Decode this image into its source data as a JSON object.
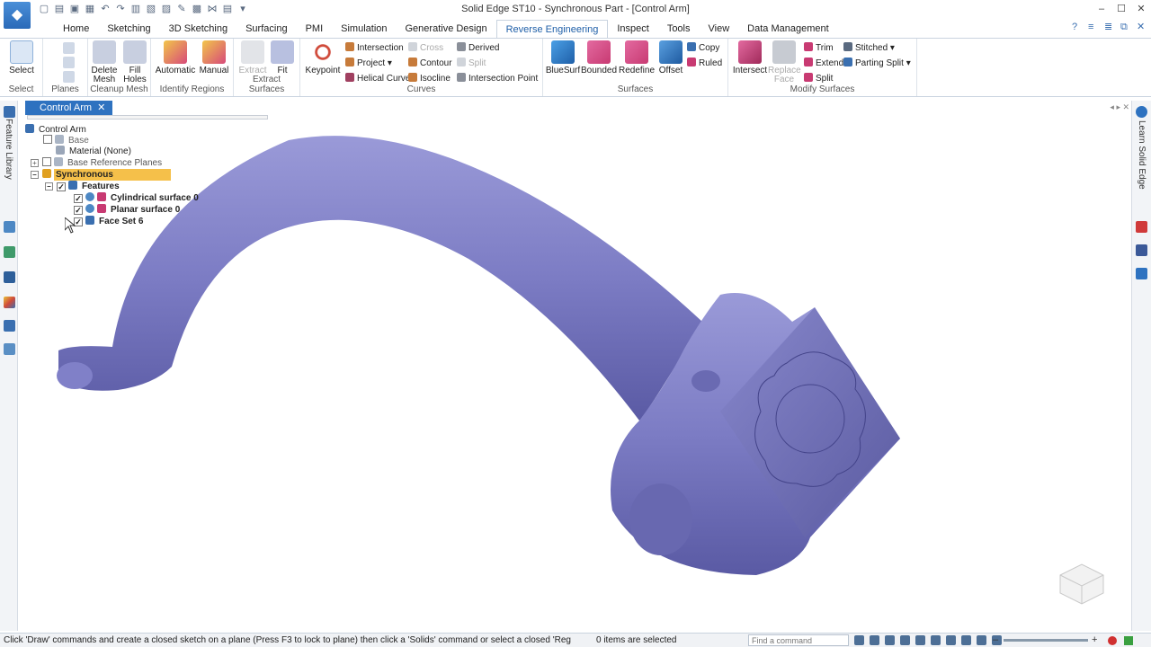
{
  "window": {
    "title": "Solid Edge ST10 - Synchronous Part - [Control Arm]"
  },
  "tabs": [
    "Home",
    "Sketching",
    "3D Sketching",
    "Surfacing",
    "PMI",
    "Simulation",
    "Generative Design",
    "Reverse Engineering",
    "Inspect",
    "Tools",
    "View",
    "Data Management"
  ],
  "active_tab": "Reverse Engineering",
  "ribbon": {
    "select": {
      "label": "Select",
      "group": "Select"
    },
    "planes_group": "Planes",
    "cleanup": {
      "delete_mesh": "Delete Mesh",
      "fill_holes": "Fill Holes",
      "group": "Cleanup Mesh"
    },
    "identify": {
      "automatic": "Automatic",
      "manual": "Manual",
      "group": "Identify Regions"
    },
    "extract": {
      "extract": "Extract",
      "fit": "Fit",
      "group": "Extract Surfaces"
    },
    "curves": {
      "keypoint": "Keypoint",
      "intersection": "Intersection",
      "cross": "Cross",
      "derived": "Derived",
      "project": "Project",
      "contour": "Contour",
      "split": "Split",
      "helical_curve": "Helical Curve",
      "isocline": "Isocline",
      "intersection_point": "Intersection Point",
      "group": "Curves"
    },
    "surfaces": {
      "bluesurf": "BlueSurf",
      "bounded": "Bounded",
      "redefine": "Redefine",
      "offset": "Offset",
      "copy": "Copy",
      "ruled": "Ruled",
      "group": "Surfaces"
    },
    "modify": {
      "intersect": "Intersect",
      "replace_face": "Replace Face",
      "trim": "Trim",
      "extend": "Extend",
      "split": "Split",
      "stitched": "Stitched",
      "parting_split": "Parting Split",
      "group": "Modify Surfaces"
    }
  },
  "document": {
    "tab_label": "Control Arm"
  },
  "side": {
    "left_label": "Feature Library",
    "right_label": "Learn Solid Edge"
  },
  "tree": {
    "root": "Control Arm",
    "base": "Base",
    "material": "Material (None)",
    "base_planes": "Base Reference Planes",
    "synchronous": "Synchronous",
    "features": "Features",
    "cyl_surface": "Cylindrical surface 0",
    "planar_surface": "Planar surface 0",
    "face_set": "Face Set 6"
  },
  "status": {
    "prompt": "Click 'Draw' commands and create a closed sketch on a plane (Press F3 to lock to plane) then click a 'Solids' command or select a closed 'Reg",
    "count": "0 items are selected",
    "search_placeholder": "Find a command"
  },
  "colors": {
    "accent": "#2e72c0",
    "model": "#7c7cc4",
    "highlight": "#f5c04a"
  }
}
